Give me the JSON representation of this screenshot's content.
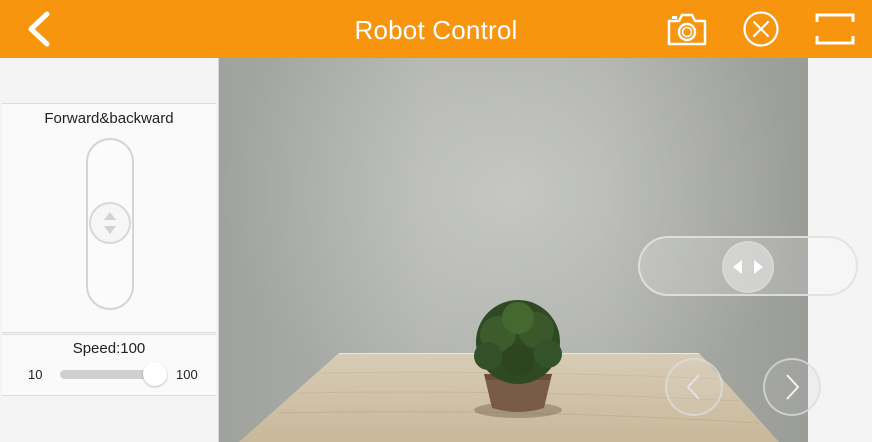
{
  "header": {
    "title": "Robot Control",
    "back_icon": "chevron-left-icon",
    "camera_icon": "camera-icon",
    "close_icon": "close-circle-icon",
    "fullscreen_icon": "fullscreen-icon"
  },
  "left_panel": {
    "forward_backward_label": "Forward&backward",
    "speed_label": "Speed:100",
    "speed_min": "10",
    "speed_max": "100",
    "speed_value": 100
  },
  "overlay": {
    "turn_slider_icon": "left-right-arrows-icon",
    "prev_icon": "chevron-left-icon",
    "next_icon": "chevron-right-icon"
  },
  "colors": {
    "accent": "#f7950f",
    "panel_bg": "#f4f4f4"
  }
}
